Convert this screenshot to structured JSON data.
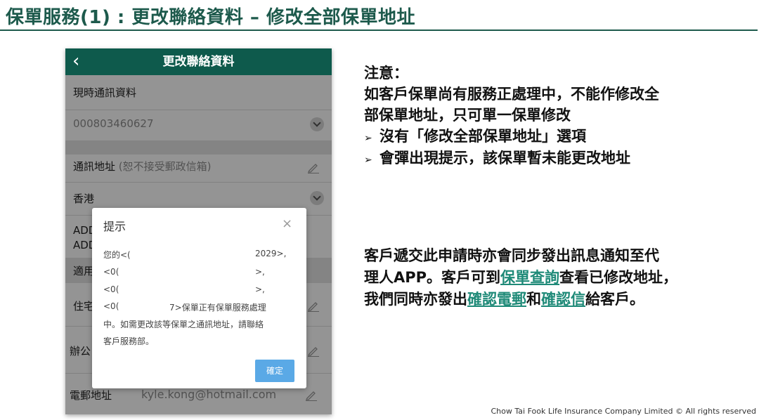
{
  "slide": {
    "title": "保單服務(1) : 更改聯絡資料 – 修改全部保單地址",
    "footer": "Chow Tai Fook Life Insurance Company Limited © All rights reserved"
  },
  "phone": {
    "back_glyph": "‹",
    "header_title": "更改聯絡資料",
    "current_label": "現時通訊資料",
    "policy_no": "000803460627",
    "address_label": "通訊地址",
    "address_hint": "(恕不接受郵政信箱)",
    "region": "香港",
    "addr_line1": "ADD",
    "addr_line2": "ADD",
    "applies_label": "適用",
    "home_label": "住宅",
    "office_label": "辦公",
    "email_label": "電郵地址",
    "email_value": "kyle.kong@hotmail.com"
  },
  "modal": {
    "title": "提示",
    "close": "×",
    "line1_start": "您的<(",
    "line1_end": "2029>,",
    "line2_start": "<0(",
    "line2_end": ">,",
    "line3_start": "<0(",
    "line3_end": ">,",
    "line4_start": "<0(",
    "line4_end": "7>保單正有保單服務處理",
    "line5": "中。如需更改該等保單之通訊地址，請聯絡",
    "line6": "客戶服務部。",
    "confirm": "確定"
  },
  "note": {
    "heading": "注意：",
    "line1": "如客戶保單尚有服務正處理中，不能作修改全",
    "line2": "部保單地址，只可單一保單修改",
    "bullet": "➢",
    "item1": "沒有「修改全部保單地址」選項",
    "item2": "會彈出現提示，該保單暫未能更改地址"
  },
  "para": {
    "l1": "客戶遞交此申請時亦會同步發出訊息通知至代",
    "l2_a": "理人APP。客戶可到",
    "l2_link": "保單查詢",
    "l2_b": "查看已修改地址，",
    "l3_a": "我們同時亦發出",
    "l3_link1": "確認電郵",
    "l3_mid": "和",
    "l3_link2": "確認信",
    "l3_b": "給客戶。"
  },
  "colors": {
    "brand": "#0e5a4c",
    "link": "#1f8a78",
    "button": "#5aa9e6"
  }
}
